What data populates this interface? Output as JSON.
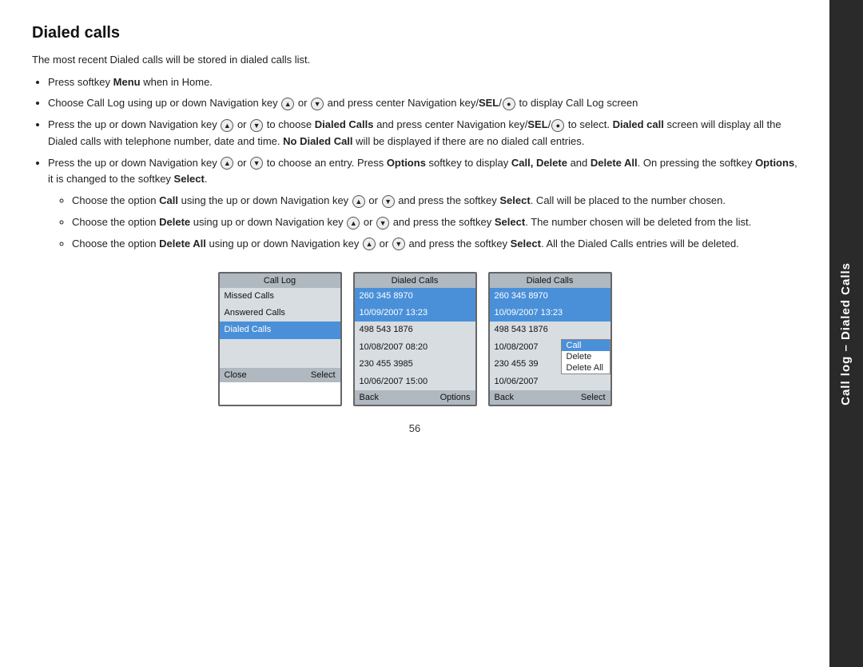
{
  "page": {
    "title": "Dialed calls",
    "intro": "The most recent Dialed calls will be stored in dialed calls list.",
    "bullets": [
      {
        "text": "Press softkey Menu when in Home."
      },
      {
        "text": "Choose Call Log using up or down Navigation key or and press center Navigation key/SEL/ to display Call Log screen"
      },
      {
        "text": "Press the up or down Navigation key or to choose Dialed Calls and press center Navigation key/SEL/ to select. Dialed call screen will display all the Dialed calls with telephone number, date and time. No Dialed Call will be displayed if there are no dialed call entries."
      },
      {
        "text": "Press the up or down Navigation key or to choose an entry. Press Options softkey to display Call, Delete and Delete All. On pressing the softkey Options, it is changed to the softkey Select."
      }
    ],
    "sub_bullets": [
      {
        "text": "Choose the option Call using the up or down Navigation key or and press the softkey Select. Call will be placed to the number chosen."
      },
      {
        "text": "Choose the option Delete using up or down Navigation key or and press the softkey Select. The number chosen will be deleted from the list."
      },
      {
        "text": "Choose the option Delete All using up or down Navigation key or and press the softkey Select. All the Dialed Calls entries will be deleted."
      }
    ],
    "page_number": "56"
  },
  "screens": {
    "screen1": {
      "header": "Call Log",
      "rows": [
        {
          "text": "Missed Calls",
          "highlighted": false
        },
        {
          "text": "Answered Calls",
          "highlighted": false
        },
        {
          "text": "Dialed Calls",
          "highlighted": true
        }
      ],
      "footer_left": "Close",
      "footer_right": "Select"
    },
    "screen2": {
      "header": "Dialed Calls",
      "rows": [
        {
          "text": "260 345 8970",
          "highlighted": true,
          "sub": false
        },
        {
          "text": "10/09/2007  13:23",
          "highlighted": true,
          "sub": false
        },
        {
          "text": "498 543 1876",
          "highlighted": false,
          "sub": false
        },
        {
          "text": "10/08/2007  08:20",
          "highlighted": false,
          "sub": false
        },
        {
          "text": "230 455 3985",
          "highlighted": false,
          "sub": false
        },
        {
          "text": "10/06/2007  15:00",
          "highlighted": false,
          "sub": false
        }
      ],
      "footer_left": "Back",
      "footer_right": "Options"
    },
    "screen3": {
      "header": "Dialed Calls",
      "rows": [
        {
          "text": "260 345 8970",
          "highlighted": true,
          "sub": false
        },
        {
          "text": "10/09/2007  13:23",
          "highlighted": true,
          "sub": false
        },
        {
          "text": "498 543 1876",
          "highlighted": false,
          "sub": false
        },
        {
          "text": "10/08/2007",
          "highlighted": false,
          "sub": false
        },
        {
          "text": "230 455 39",
          "highlighted": false,
          "sub": false
        },
        {
          "text": "10/06/2007",
          "highlighted": false,
          "sub": false
        }
      ],
      "context_menu": [
        "Call",
        "Delete",
        "Delete All"
      ],
      "footer_left": "Back",
      "footer_right": "Select"
    }
  },
  "sidebar": {
    "label": "Call log – Dialed Calls"
  }
}
